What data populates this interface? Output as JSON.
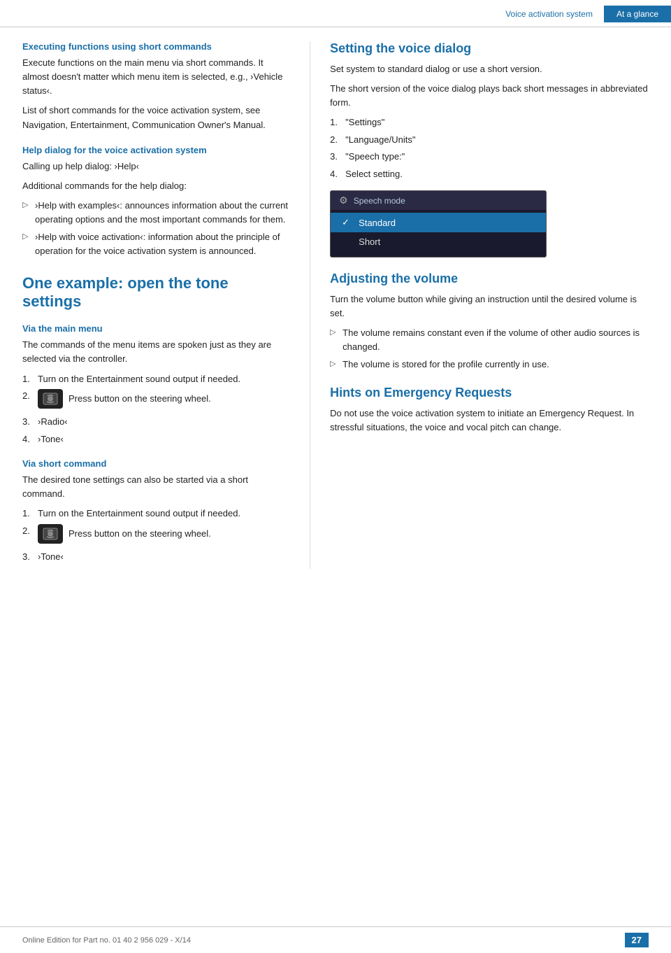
{
  "header": {
    "section1": "Voice activation system",
    "section2": "At a glance"
  },
  "left_col": {
    "executing_heading": "Executing functions using short commands",
    "executing_p1": "Execute functions on the main menu via short commands. It almost doesn't matter which menu item is selected, e.g., ›Vehicle status‹.",
    "executing_p2": "List of short commands for the voice activation system, see Navigation, Entertainment, Communication Owner's Manual.",
    "help_dialog_heading": "Help dialog for the voice activation system",
    "help_dialog_p1": "Calling up help dialog: ›Help‹",
    "help_dialog_p2": "Additional commands for the help dialog:",
    "help_bullets": [
      "›Help with examples‹: announces information about the current operating options and the most important commands for them.",
      "›Help with voice activation‹: information about the principle of operation for the voice activation system is announced."
    ],
    "tone_heading": "One example: open the tone settings",
    "via_main_menu_heading": "Via the main menu",
    "via_main_menu_p": "The commands of the menu items are spoken just as they are selected via the controller.",
    "steps_main": [
      "Turn on the Entertainment sound output if needed.",
      "Press button on the steering wheel.",
      "›Radio‹",
      "›Tone‹"
    ],
    "via_short_cmd_heading": "Via short command",
    "via_short_cmd_p": "The desired tone settings can also be started via a short command.",
    "steps_short": [
      "Turn on the Entertainment sound output if needed.",
      "Press button on the steering wheel.",
      "›Tone‹"
    ]
  },
  "right_col": {
    "setting_voice_dialog_heading": "Setting the voice dialog",
    "setting_voice_dialog_p1": "Set system to standard dialog or use a short version.",
    "setting_voice_dialog_p2": "The short version of the voice dialog plays back short messages in abbreviated form.",
    "steps_voice": [
      "\"Settings\"",
      "\"Language/Units\"",
      "\"Speech type:\"",
      "Select setting."
    ],
    "speech_mode": {
      "title": "Speech mode",
      "options": [
        {
          "label": "Standard",
          "selected": true
        },
        {
          "label": "Short",
          "selected": false
        }
      ]
    },
    "adjusting_volume_heading": "Adjusting the volume",
    "adjusting_volume_p": "Turn the volume button while giving an instruction until the desired volume is set.",
    "volume_bullets": [
      "The volume remains constant even if the volume of other audio sources is changed.",
      "The volume is stored for the profile currently in use."
    ],
    "hints_heading": "Hints on Emergency Requests",
    "hints_p": "Do not use the voice activation system to initiate an Emergency Request. In stressful situations, the voice and vocal pitch can change."
  },
  "footer": {
    "text": "Online Edition for Part no. 01 40 2 956 029 - X/14",
    "page": "27"
  }
}
